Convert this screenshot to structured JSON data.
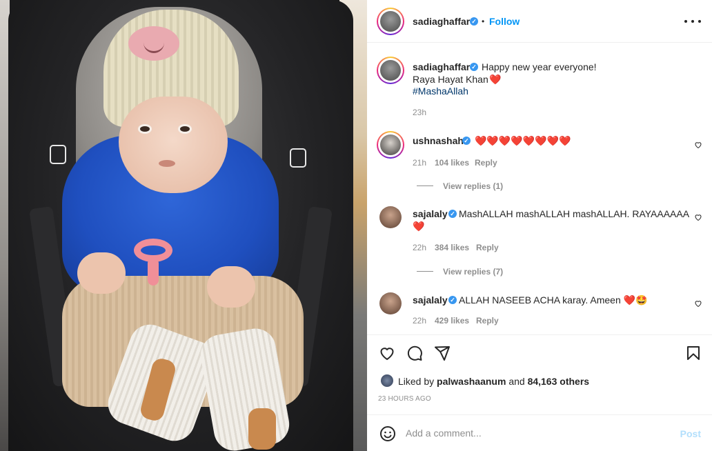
{
  "post": {
    "author": "sadiaghaffar",
    "follow_label": "Follow",
    "dot": "•",
    "caption": {
      "line1": "Happy new year everyone!",
      "line2": "Raya Hayat Khan",
      "heart": "❤️",
      "hashtag": "#MashaAllah",
      "time": "23h"
    },
    "comments": [
      {
        "user": "ushnashah",
        "text": "❤️❤️❤️❤️❤️❤️❤️❤️",
        "time": "21h",
        "likes": "104 likes",
        "reply": "Reply",
        "view_replies": "View replies (1)"
      },
      {
        "user": "sajalaly",
        "text": "MashALLAH mashALLAH mashALLAH. RAYAAAAAA",
        "text2": "❤️",
        "time": "22h",
        "likes": "384 likes",
        "reply": "Reply",
        "view_replies": "View replies (7)"
      },
      {
        "user": "sajalaly",
        "text": "ALLAH NASEEB ACHA karay. Ameen ❤️🤩",
        "time": "22h",
        "likes": "429 likes",
        "reply": "Reply"
      }
    ],
    "liked_by": {
      "prefix": "Liked by",
      "user": "palwashaanum",
      "middle": "and",
      "count": "84,163 others"
    },
    "time_ago": "23 HOURS AGO",
    "add_comment_placeholder": "Add a comment...",
    "post_label": "Post"
  },
  "icons": {
    "verified": "verified-badge-icon",
    "more": "more-options-icon",
    "heart": "heart-icon",
    "comment": "comment-icon",
    "share": "share-icon",
    "bookmark": "bookmark-icon",
    "emoji": "emoji-icon"
  },
  "colors": {
    "accent": "#0095f6",
    "verified": "#3897f0",
    "hashtag": "#00376b",
    "muted": "#8e8e8e"
  }
}
